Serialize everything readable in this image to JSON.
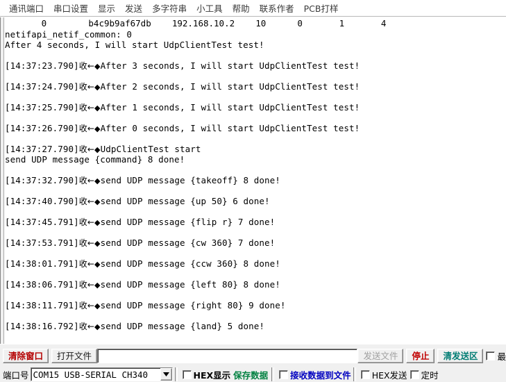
{
  "menubar": {
    "items": [
      {
        "label": "通讯端口",
        "name": "menu-comm-port"
      },
      {
        "label": "串口设置",
        "name": "menu-serial-settings"
      },
      {
        "label": "显示",
        "name": "menu-display"
      },
      {
        "label": "发送",
        "name": "menu-send"
      },
      {
        "label": "多字符串",
        "name": "menu-multi-string"
      },
      {
        "label": "小工具",
        "name": "menu-tools"
      },
      {
        "label": "帮助",
        "name": "menu-help"
      },
      {
        "label": "联系作者",
        "name": "menu-contact-author"
      },
      {
        "label": "PCB打样",
        "name": "menu-pcb-proofing"
      }
    ]
  },
  "terminal": {
    "header_line": "       0        b4c9b9af67db    192.168.10.2    10      0       1       4",
    "header_values": {
      "index": "0",
      "mac": "b4c9b9af67db",
      "ip": "192.168.10.2",
      "col4": "10",
      "col5": "0",
      "col6": "1",
      "col7": "4"
    },
    "recv_marker": "收",
    "arrow_marker": "←",
    "diamond_marker": "◆",
    "lines": [
      {
        "type": "plain",
        "text": "netifapi_netif_common: 0"
      },
      {
        "type": "plain",
        "text": "After 4 seconds, I will start UdpClientTest test!"
      },
      {
        "type": "blank",
        "text": ""
      },
      {
        "type": "stamped",
        "time": "[14:37:23.790]",
        "text": "After 3 seconds, I will start UdpClientTest test!"
      },
      {
        "type": "blank",
        "text": ""
      },
      {
        "type": "stamped",
        "time": "[14:37:24.790]",
        "text": "After 2 seconds, I will start UdpClientTest test!"
      },
      {
        "type": "blank",
        "text": ""
      },
      {
        "type": "stamped",
        "time": "[14:37:25.790]",
        "text": "After 1 seconds, I will start UdpClientTest test!"
      },
      {
        "type": "blank",
        "text": ""
      },
      {
        "type": "stamped",
        "time": "[14:37:26.790]",
        "text": "After 0 seconds, I will start UdpClientTest test!"
      },
      {
        "type": "blank",
        "text": ""
      },
      {
        "type": "stamped",
        "time": "[14:37:27.790]",
        "text": "UdpClientTest start"
      },
      {
        "type": "plain",
        "text": "send UDP message {command} 8 done!"
      },
      {
        "type": "blank",
        "text": ""
      },
      {
        "type": "stamped",
        "time": "[14:37:32.790]",
        "text": "send UDP message {takeoff} 8 done!"
      },
      {
        "type": "blank",
        "text": ""
      },
      {
        "type": "stamped",
        "time": "[14:37:40.790]",
        "text": "send UDP message {up 50} 6 done!"
      },
      {
        "type": "blank",
        "text": ""
      },
      {
        "type": "stamped",
        "time": "[14:37:45.791]",
        "text": "send UDP message {flip r} 7 done!"
      },
      {
        "type": "blank",
        "text": ""
      },
      {
        "type": "stamped",
        "time": "[14:37:53.791]",
        "text": "send UDP message {cw 360} 7 done!"
      },
      {
        "type": "blank",
        "text": ""
      },
      {
        "type": "stamped",
        "time": "[14:38:01.791]",
        "text": "send UDP message {ccw 360} 8 done!"
      },
      {
        "type": "blank",
        "text": ""
      },
      {
        "type": "stamped",
        "time": "[14:38:06.791]",
        "text": "send UDP message {left 80} 8 done!"
      },
      {
        "type": "blank",
        "text": ""
      },
      {
        "type": "stamped",
        "time": "[14:38:11.791]",
        "text": "send UDP message {right 80} 9 done!"
      },
      {
        "type": "blank",
        "text": ""
      },
      {
        "type": "stamped",
        "time": "[14:38:16.792]",
        "text": "send UDP message {land} 5 done!"
      }
    ]
  },
  "toolbar": {
    "clear_window_label": "清除窗口",
    "open_file_label": "打开文件",
    "file_path_value": "",
    "file_path_placeholder": "",
    "send_file_label": "发送文件",
    "stop_label": "停止",
    "clear_send_label": "清发送区",
    "topmost_label": "最",
    "topmost_checked": false
  },
  "settings": {
    "port_label": "端口号",
    "port_value": "COM15 USB-SERIAL CH340",
    "hex_display_label": "HEX显示",
    "hex_display_checked": false,
    "save_data_label": "保存数据",
    "recv_to_file_label": "接收数据到文件",
    "recv_to_file_checked": false,
    "hex_send_label": "HEX发送",
    "hex_send_checked": false,
    "timed_send_label": "定时",
    "timed_send_checked": false
  },
  "colors": {
    "clear_window": "#b40000",
    "stop": "#c00000",
    "clear_send": "#007c73",
    "save_data": "#008040",
    "recv_to_file": "#0000c0",
    "background": "#f0f0f0",
    "terminal_bg": "#ffffff"
  }
}
